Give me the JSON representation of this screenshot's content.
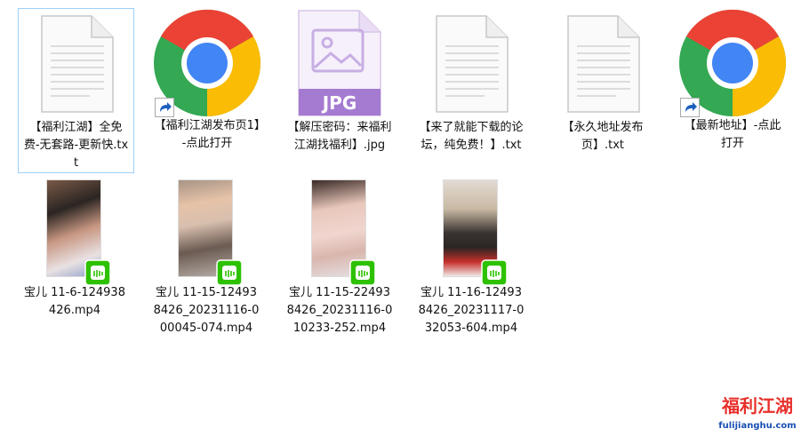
{
  "files_row1": [
    {
      "label": "【福利江湖】全免费-无套路-更新快.txt",
      "icon": "text-file-icon"
    },
    {
      "label": "【福利江湖发布页1】-点此打开",
      "icon": "chrome-shortcut-icon"
    },
    {
      "label": "【解压密码：来福利江湖找福利】.jpg",
      "icon": "jpg-file-icon",
      "badge_text": "JPG"
    },
    {
      "label": "【来了就能下载的论坛，纯免费！】.txt",
      "icon": "text-file-icon"
    },
    {
      "label": "【永久地址发布页】.txt",
      "icon": "text-file-icon"
    },
    {
      "label": "【最新地址】-点此打开",
      "icon": "chrome-shortcut-icon"
    }
  ],
  "files_row2": [
    {
      "label": "宝儿 11-6-124938426.mp4",
      "icon": "video-thumbnail"
    },
    {
      "label": "宝儿 11-15-124938426_20231116-000045-074.mp4",
      "icon": "video-thumbnail"
    },
    {
      "label": "宝儿 11-15-224938426_20231116-010233-252.mp4",
      "icon": "video-thumbnail"
    },
    {
      "label": "宝儿 11-16-124938426_20231117-032053-604.mp4",
      "icon": "video-thumbnail"
    }
  ],
  "watermark": {
    "title": "福利江湖",
    "url": "fulijianghu.com"
  },
  "colors": {
    "selection_border": "#99d1ff",
    "jpg_badge": "#a57bd1",
    "wechat_green": "#2dc100"
  }
}
